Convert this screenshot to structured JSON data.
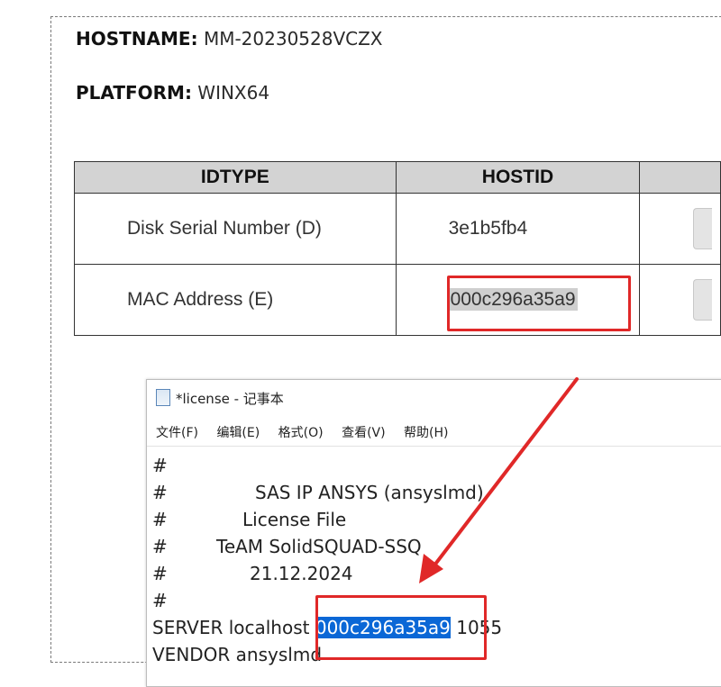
{
  "hostname": {
    "label": "HOSTNAME:",
    "value": "MM-20230528VCZX"
  },
  "platform": {
    "label": "PLATFORM:",
    "value": "WINX64"
  },
  "host_table": {
    "headers": [
      "IDTYPE",
      "HOSTID",
      ""
    ],
    "rows": [
      {
        "idtype": "Disk Serial Number (D)",
        "hostid": "3e1b5fb4"
      },
      {
        "idtype": "MAC Address (E)",
        "hostid": "000c296a35a9"
      }
    ]
  },
  "notepad": {
    "title": "*license - 记事本",
    "menu": [
      "文件(F)",
      "编辑(E)",
      "格式(O)",
      "查看(V)",
      "帮助(H)"
    ],
    "lines": [
      {
        "hash": "#",
        "text": ""
      },
      {
        "hash": "#",
        "text": "SAS IP ANSYS (ansyslmd)"
      },
      {
        "hash": "#",
        "text": "License File"
      },
      {
        "hash": "#",
        "text": "TeAM SolidSQUAD-SSQ"
      },
      {
        "hash": "#",
        "text": "21.12.2024"
      },
      {
        "hash": "#",
        "text": ""
      }
    ],
    "server": {
      "prefix": "SERVER localhost ",
      "hostid": "000c296a35a9",
      "port": " 1055"
    },
    "vendor": "VENDOR ansyslmd"
  },
  "colors": {
    "annotation_red": "#e02828",
    "selection_blue": "#0a67d6",
    "header_gray": "#d3d3d3"
  },
  "icons": [
    "document-icon",
    "arrow-annotation"
  ]
}
